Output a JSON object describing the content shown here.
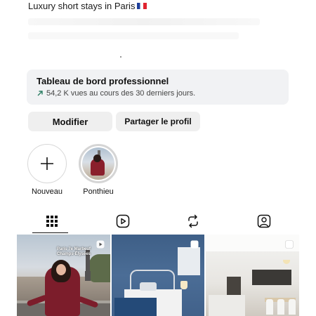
{
  "profile": {
    "bio": "Luxury short stays in Paris",
    "bio_flag": "france-flag-icon"
  },
  "dashboard": {
    "title": "Tableau de bord professionnel",
    "stats": "54,2 K vues au cours des 30 derniers jours.",
    "stats_icon": "trend-arrow-icon"
  },
  "actions": {
    "edit_label": "Modifier",
    "share_label": "Partager le profil"
  },
  "highlights": [
    {
      "label": "Nouveau",
      "icon": "plus-icon"
    },
    {
      "label": "Ponthieu",
      "icon": "highlight-cover"
    }
  ],
  "tabs": [
    {
      "name": "grid",
      "icon": "grid-icon",
      "active": true
    },
    {
      "name": "reels",
      "icon": "reels-icon",
      "active": false
    },
    {
      "name": "reposts",
      "icon": "repost-icon",
      "active": false
    },
    {
      "name": "tagged",
      "icon": "tagged-icon",
      "active": false
    }
  ],
  "posts": [
    {
      "type": "reel",
      "caption": "Paris 7e\nMarbeuf Champs-Élysées",
      "badge": "reel-icon"
    },
    {
      "type": "carousel",
      "badge": "carousel-icon"
    },
    {
      "type": "carousel",
      "badge": "carousel-icon"
    }
  ],
  "colors": {
    "dashboard_bg": "#f1f2f4",
    "button_bg": "#efefef",
    "flag_blue": "#1f3f9b",
    "flag_red": "#e0242f"
  }
}
